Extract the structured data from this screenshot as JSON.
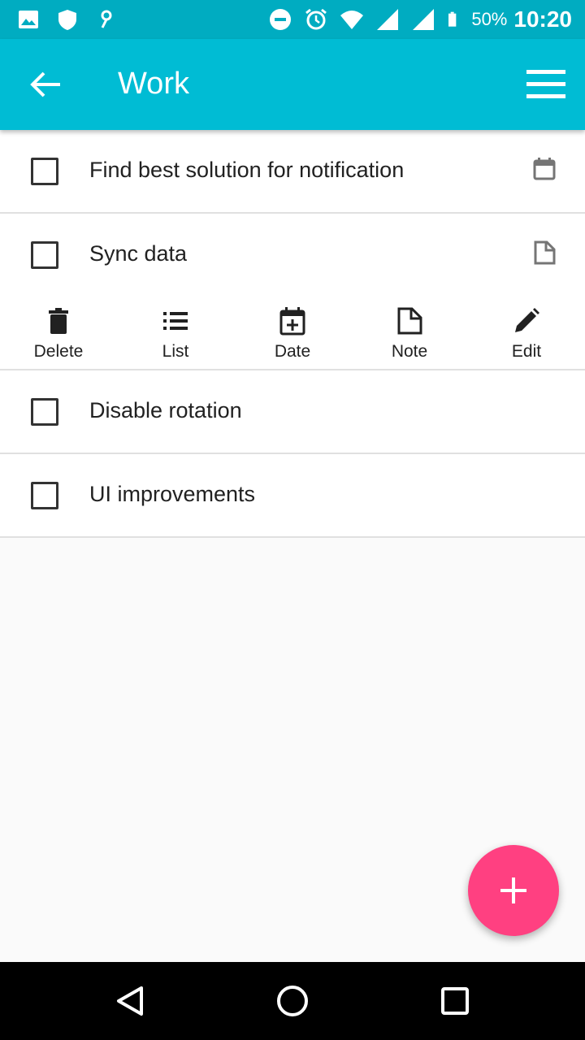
{
  "status_bar": {
    "battery_percent": "50%",
    "time": "10:20",
    "left_icons": [
      "image-icon",
      "shield-icon",
      "key-icon"
    ],
    "right_icons": [
      "do-not-disturb-icon",
      "alarm-icon",
      "wifi-icon",
      "signal-icon",
      "signal-icon",
      "battery-icon"
    ]
  },
  "app_bar": {
    "title": "Work",
    "background": "#00bcd4",
    "back_icon": "arrow-back-icon",
    "menu_icon": "menu-icon"
  },
  "tasks": [
    {
      "label": "Find best solution for notification",
      "checked": false,
      "indicator_icon": "calendar-icon"
    },
    {
      "label": "Sync data",
      "checked": false,
      "indicator_icon": "note-icon",
      "expanded": true
    },
    {
      "label": "Disable rotation",
      "checked": false
    },
    {
      "label": "UI improvements",
      "checked": false
    }
  ],
  "actions": [
    {
      "label": "Delete",
      "icon": "delete-icon"
    },
    {
      "label": "List",
      "icon": "list-icon"
    },
    {
      "label": "Date",
      "icon": "date-add-icon"
    },
    {
      "label": "Note",
      "icon": "note-icon"
    },
    {
      "label": "Edit",
      "icon": "edit-icon"
    }
  ],
  "fab": {
    "icon": "add-icon",
    "color": "#ff4081"
  },
  "nav_bar": {
    "icons": [
      "back-triangle-icon",
      "home-circle-icon",
      "recents-square-icon"
    ]
  }
}
